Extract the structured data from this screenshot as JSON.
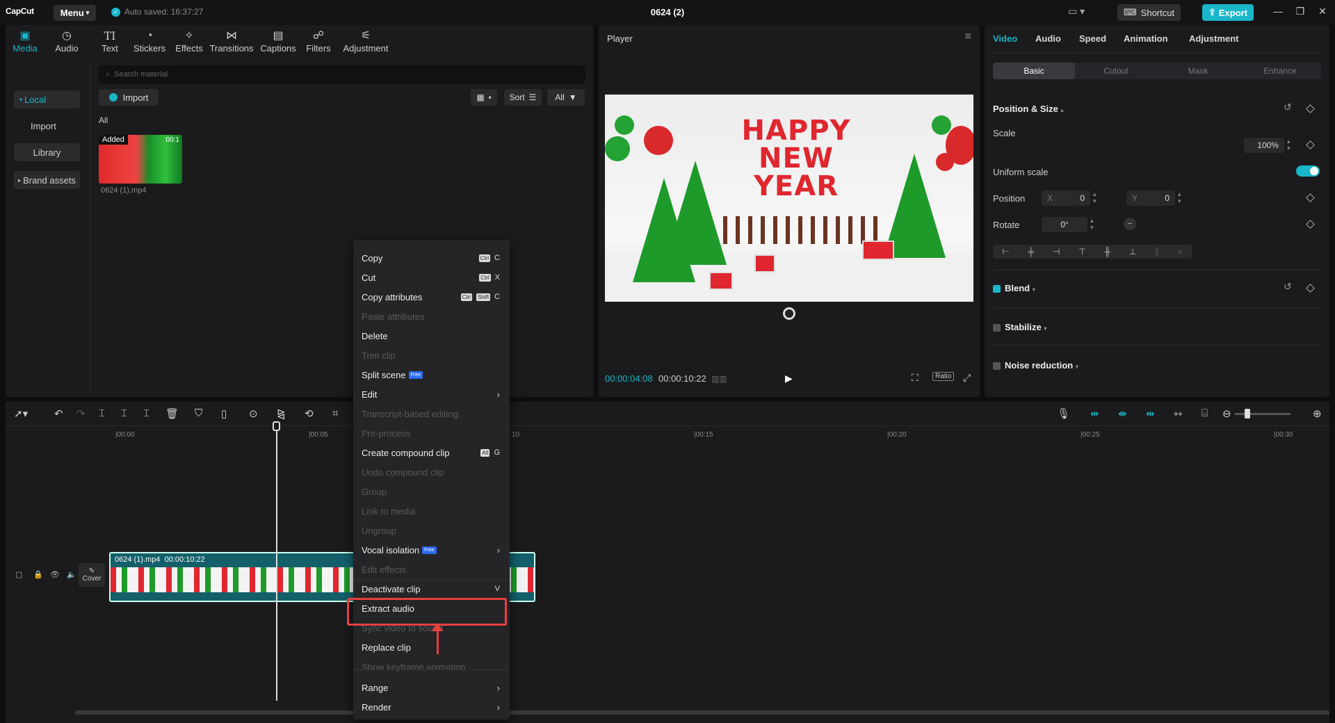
{
  "titlebar": {
    "logo": "CapCut",
    "menu_label": "Menu",
    "autosave": "Auto saved: 16:37:27",
    "project_title": "0624 (2)",
    "shortcut_label": "Shortcut",
    "export_label": "Export"
  },
  "media": {
    "tabs": [
      {
        "label": "Media",
        "icon": "media-icon"
      },
      {
        "label": "Audio",
        "icon": "audio-icon"
      },
      {
        "label": "Text",
        "icon": "text-icon"
      },
      {
        "label": "Stickers",
        "icon": "stickers-icon"
      },
      {
        "label": "Effects",
        "icon": "effects-icon"
      },
      {
        "label": "Transitions",
        "icon": "transitions-icon"
      },
      {
        "label": "Captions",
        "icon": "captions-icon"
      },
      {
        "label": "Filters",
        "icon": "filters-icon"
      },
      {
        "label": "Adjustment",
        "icon": "adjustment-icon"
      }
    ],
    "sidebar": {
      "local": "Local",
      "import": "Import",
      "library": "Library",
      "brand_assets": "Brand assets"
    },
    "search_placeholder": "Search material",
    "import_label": "Import",
    "sort_label": "Sort",
    "all_filter_label": "All",
    "section_label": "All",
    "item": {
      "badge": "Added",
      "duration": "00:1",
      "name": "0624 (1).mp4"
    }
  },
  "player": {
    "title": "Player",
    "video_text": [
      "HAPPY",
      "NEW",
      "YEAR"
    ],
    "current_time": "00:00:04:08",
    "total_time": "00:00:10:22",
    "ratio_label": "Ratio"
  },
  "props": {
    "tabs": [
      "Video",
      "Audio",
      "Speed",
      "Animation",
      "Adjustment"
    ],
    "subtabs": [
      "Basic",
      "Cutout",
      "Mask",
      "Enhance"
    ],
    "position_size_title": "Position & Size",
    "scale_label": "Scale",
    "scale_value": "100%",
    "uniform_scale_label": "Uniform scale",
    "position_label": "Position",
    "pos_x_label": "X",
    "pos_x_value": "0",
    "pos_y_label": "Y",
    "pos_y_value": "0",
    "rotate_label": "Rotate",
    "rotate_value": "0°",
    "blend_label": "Blend",
    "stabilize_label": "Stabilize",
    "noise_reduction_label": "Noise reduction"
  },
  "timeline": {
    "ruler": [
      "|00:00",
      "|00:05",
      "10",
      "|00:15",
      "|00:20",
      "|00:25",
      "|00:30"
    ],
    "cover_label": "Cover",
    "clip_name": "0624 (1).mp4",
    "clip_duration": "00:00:10:22"
  },
  "context_menu": {
    "items": [
      {
        "label": "Copy",
        "shortcut_keys": [
          "Ctrl"
        ],
        "shortcut_letter": "C",
        "disabled": false
      },
      {
        "label": "Cut",
        "shortcut_keys": [
          "Ctrl"
        ],
        "shortcut_letter": "X",
        "disabled": false
      },
      {
        "label": "Copy attributes",
        "shortcut_keys": [
          "Ctrl",
          "Shift"
        ],
        "shortcut_letter": "C",
        "disabled": false
      },
      {
        "label": "Paste attributes",
        "disabled": true
      },
      {
        "label": "Delete",
        "disabled": false
      },
      {
        "label": "Trim clip",
        "disabled": true
      },
      {
        "label": "Split scene",
        "badge": "Free",
        "disabled": false
      },
      {
        "label": "Edit",
        "submenu": true,
        "disabled": false
      },
      {
        "label": "Transcript-based editing",
        "disabled": true
      },
      {
        "label": "Pre-process",
        "disabled": true
      },
      {
        "label": "Create compound clip",
        "shortcut_keys": [
          "Alt"
        ],
        "shortcut_letter": "G",
        "disabled": false
      },
      {
        "label": "Undo compound clip",
        "disabled": true
      },
      {
        "label": "Group",
        "disabled": true
      },
      {
        "label": "Link to media",
        "disabled": true
      },
      {
        "label": "Ungroup",
        "disabled": true
      },
      {
        "label": "Vocal isolation",
        "badge": "Free",
        "submenu": true,
        "disabled": false
      },
      {
        "label": "Edit effects",
        "disabled": true
      },
      {
        "label": "Deactivate clip",
        "shortcut_letter": "V",
        "disabled": false
      },
      {
        "label": "Extract audio",
        "disabled": false
      },
      {
        "label": "Sync video to sound",
        "disabled": true
      },
      {
        "label": "Replace clip",
        "disabled": false
      },
      {
        "label": "Show keyframe animation",
        "disabled": true
      },
      {
        "label": "Range",
        "submenu": true,
        "disabled": false
      },
      {
        "label": "Render",
        "submenu": true,
        "disabled": false
      }
    ]
  },
  "colors": {
    "accent": "#19b6c9",
    "highlight": "#e74040"
  }
}
